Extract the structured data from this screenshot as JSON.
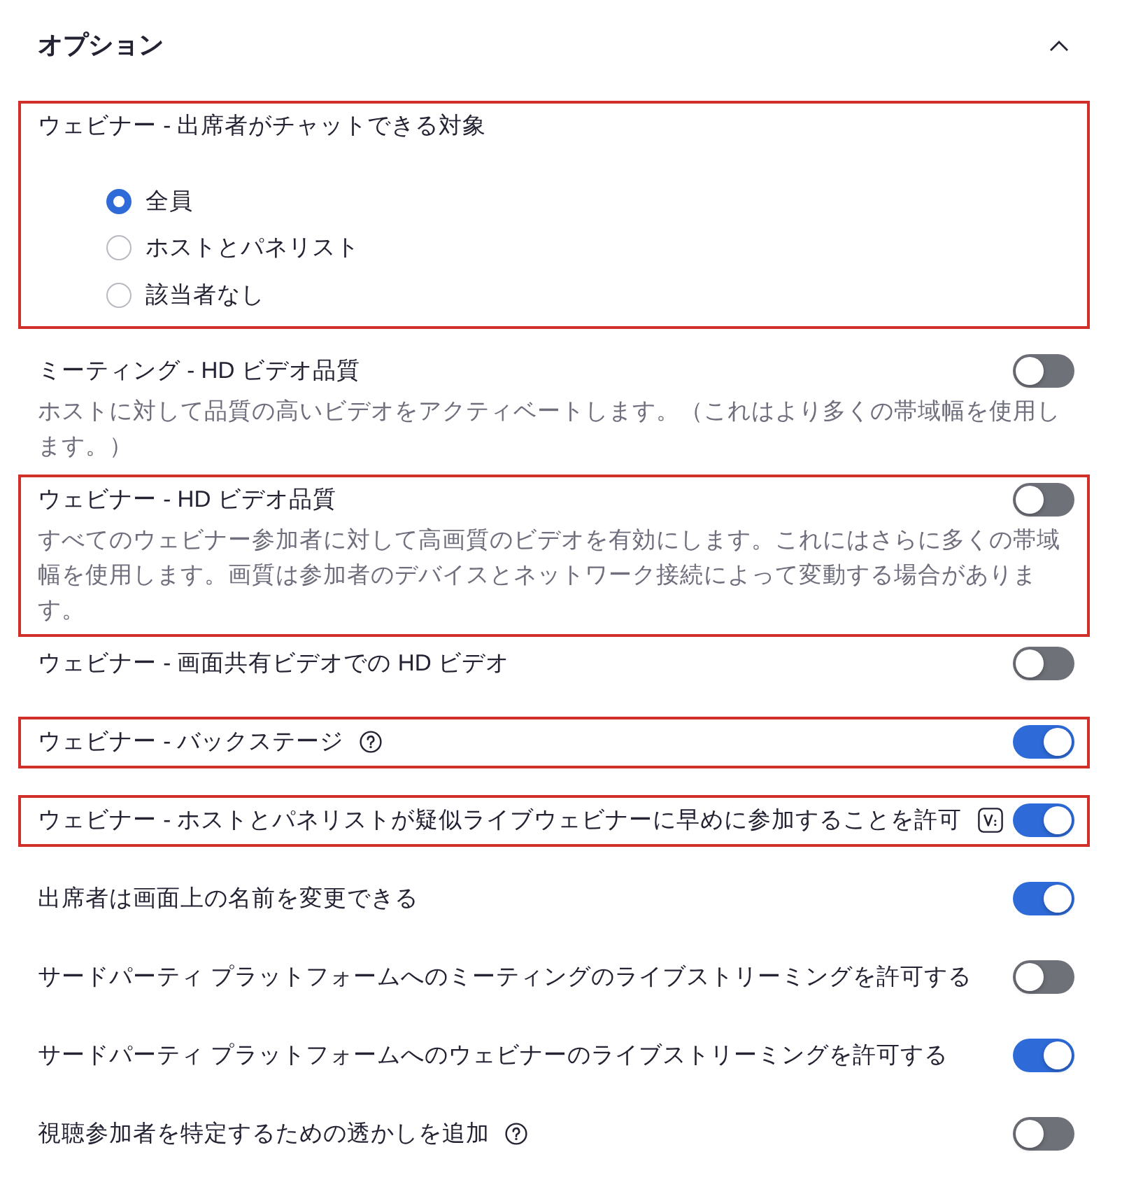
{
  "section": {
    "title": "オプション",
    "expanded": true
  },
  "settings": [
    {
      "kind": "radio_group",
      "label": "ウェビナー - 出席者がチャットできる対象",
      "highlighted": true,
      "options": [
        {
          "label": "全員",
          "selected": true
        },
        {
          "label": "ホストとパネリスト",
          "selected": false
        },
        {
          "label": "該当者なし",
          "selected": false
        }
      ]
    },
    {
      "kind": "toggle",
      "label": "ミーティング - HD ビデオ品質",
      "description": "ホストに対して品質の高いビデオをアクティベートします。（これはより多くの帯域幅を使用します。）",
      "on": false,
      "highlighted": false
    },
    {
      "kind": "toggle",
      "label": "ウェビナー - HD ビデオ品質",
      "description": "すべてのウェビナー参加者に対して高画質のビデオを有効にします。これにはさらに多くの帯域幅を使用します。画質は参加者のデバイスとネットワーク接続によって変動する場合があります。",
      "on": false,
      "highlighted": true
    },
    {
      "kind": "toggle",
      "label": "ウェビナー - 画面共有ビデオでの HD ビデオ",
      "on": false,
      "highlighted": false
    },
    {
      "kind": "helptoggle",
      "label": "ウェビナー - バックステージ",
      "on": true,
      "highlighted": true
    },
    {
      "kind": "tagtoggle",
      "label": "ウェビナー - ホストとパネリストが疑似ライブウェビナーに早めに参加することを許可",
      "on": true,
      "highlighted": true
    },
    {
      "kind": "toggle",
      "label": "出席者は画面上の名前を変更できる",
      "on": true,
      "highlighted": false
    },
    {
      "kind": "toggle",
      "label": "サードパーティ プラットフォームへのミーティングのライブストリーミングを許可する",
      "on": false,
      "highlighted": false
    },
    {
      "kind": "toggle",
      "label": "サードパーティ プラットフォームへのウェビナーのライブストリーミングを許可する",
      "on": true,
      "highlighted": false
    },
    {
      "kind": "helptoggle",
      "label": "視聴参加者を特定するための透かしを追加",
      "on": false,
      "highlighted": false
    }
  ]
}
